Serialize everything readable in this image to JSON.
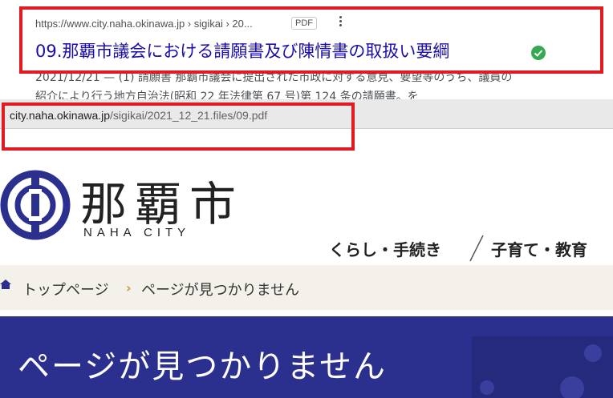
{
  "search_result": {
    "breadcrumb": "https://www.city.naha.okinawa.jp › sigikai › 20...",
    "badge": "PDF",
    "title": "09.那覇市議会における請願書及び陳情書の取扱い要綱",
    "snippet_line1": "2021/12/21 — (1) 請願書 那覇市議会に提出された市政に対する意見、要望等のうち、議員の",
    "snippet_line2": "紹介により行う地方自治法(昭和 22 年法律第 67 号)第 124 条の請願書。を"
  },
  "address_bar": {
    "host": "city.naha.okinawa.jp",
    "path": "/sigikai/2021_12_21.files/09.pdf"
  },
  "site": {
    "logo_kanji": "那覇市",
    "logo_en": "NAHA CITY",
    "nav": [
      "くらし・手続き",
      "子育て・教育"
    ],
    "breadcrumb": [
      "トップページ",
      "ページが見つかりません"
    ],
    "page_title": "ページが見つかりません"
  },
  "colors": {
    "highlight": "#e21b23",
    "banner": "#2b2f8e",
    "link": "#1a0dab"
  }
}
